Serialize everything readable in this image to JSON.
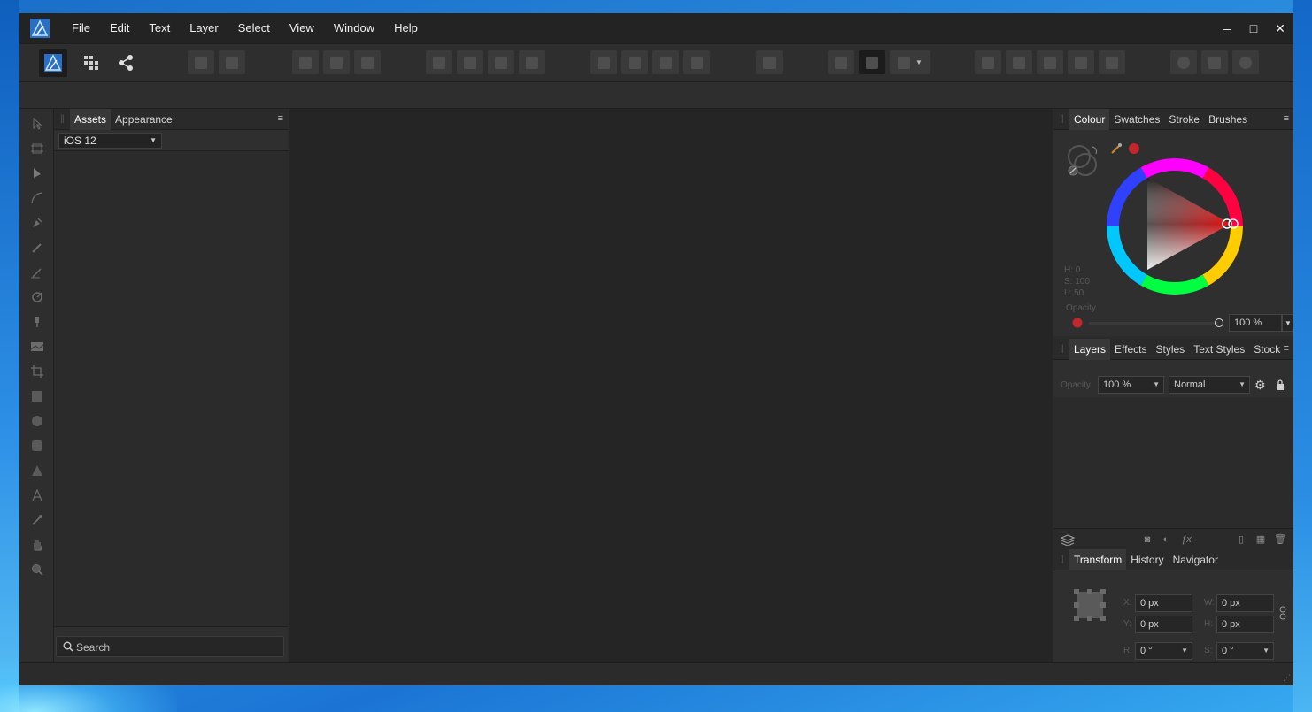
{
  "window": {
    "menu": [
      "File",
      "Edit",
      "Text",
      "Layer",
      "Select",
      "View",
      "Window",
      "Help"
    ],
    "controls": {
      "minimize": "–",
      "maximize": "□",
      "close": "✕"
    }
  },
  "assets_panel": {
    "tabs": [
      "Assets",
      "Appearance"
    ],
    "category": "iOS 12",
    "search_placeholder": "Search"
  },
  "colour_panel": {
    "tabs": [
      "Colour",
      "Swatches",
      "Stroke",
      "Brushes"
    ],
    "hsl": {
      "h": "H: 0",
      "s": "S: 100",
      "l": "L: 50"
    },
    "opacity_label": "Opacity",
    "opacity_value": "100 %",
    "current_colour": "#c1272d"
  },
  "layers_panel": {
    "tabs": [
      "Layers",
      "Effects",
      "Styles",
      "Text Styles",
      "Stock"
    ],
    "opacity_label": "Opacity",
    "opacity_value": "100 %",
    "blend_mode": "Normal"
  },
  "transform_panel": {
    "tabs": [
      "Transform",
      "History",
      "Navigator"
    ],
    "x_label": "X:",
    "x_value": "0 px",
    "y_label": "Y:",
    "y_value": "0 px",
    "w_label": "W:",
    "w_value": "0 px",
    "h_label": "H:",
    "h_value": "0 px",
    "r_label": "R:",
    "r_value": "0 °",
    "s_label": "S:",
    "s_value": "0 °"
  }
}
